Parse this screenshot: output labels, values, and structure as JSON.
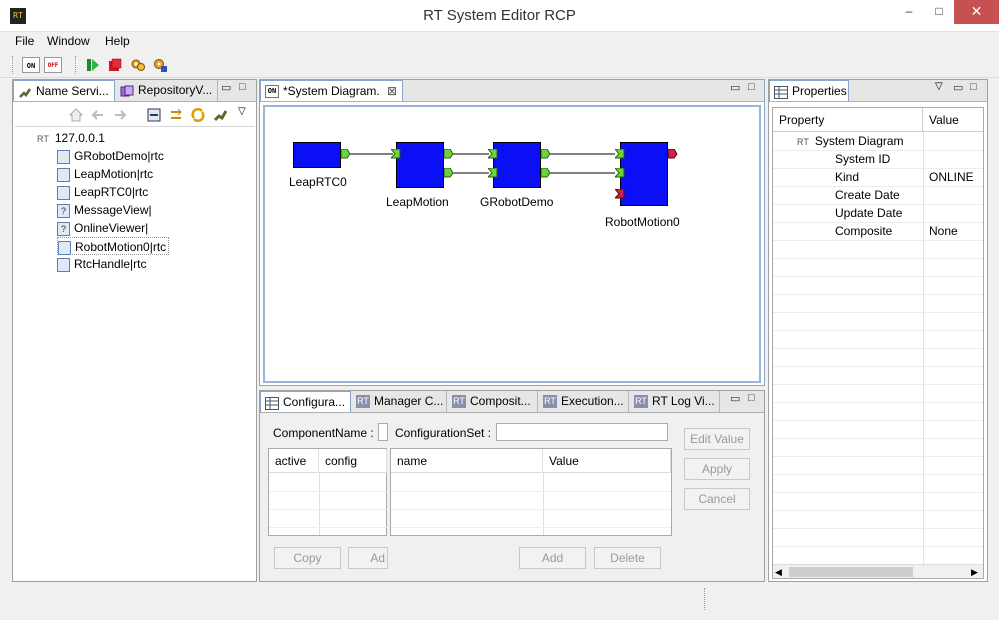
{
  "window": {
    "title": "RT System Editor RCP",
    "app_icon": "RT",
    "min": "–",
    "max": "□",
    "close": "✕"
  },
  "menu": [
    "File",
    "Window",
    "Help"
  ],
  "toolbar": {
    "on_label": "ON",
    "off_label": "OFF"
  },
  "name_service": {
    "tabs": [
      "Name Servi...",
      "RepositoryV..."
    ],
    "root": "127.0.0.1",
    "root_icon": "RT",
    "items": [
      "GRobotDemo|rtc",
      "LeapMotion|rtc",
      "LeapRTC0|rtc",
      "MessageView|",
      "OnlineViewer|",
      "RobotMotion0|rtc",
      "RtcHandle|rtc"
    ],
    "unknown_glyph": "?"
  },
  "diagram": {
    "tab": "*System Diagram.",
    "tab_icon": "ON",
    "components": [
      "LeapRTC0",
      "LeapMotion",
      "GRobotDemo",
      "RobotMotion0"
    ]
  },
  "config_panel": {
    "tabs": [
      "Configura...",
      "Manager C...",
      "Composit...",
      "Execution...",
      "RT Log Vi..."
    ],
    "component_name_label": "ComponentName :",
    "configuration_set_label": "ConfigurationSet :",
    "left_headers": [
      "active",
      "config"
    ],
    "right_headers": [
      "name",
      "Value"
    ],
    "buttons": {
      "edit_value": "Edit Value",
      "apply": "Apply",
      "cancel": "Cancel",
      "copy": "Copy",
      "add_left": "Ad",
      "add": "Add",
      "delete": "Delete"
    }
  },
  "properties": {
    "tab": "Properties",
    "headers": [
      "Property",
      "Value"
    ],
    "root": "System Diagram",
    "root_icon": "RT",
    "rows": [
      {
        "name": "System ID",
        "value": ""
      },
      {
        "name": "Kind",
        "value": "ONLINE"
      },
      {
        "name": "Create Date",
        "value": ""
      },
      {
        "name": "Update Date",
        "value": ""
      },
      {
        "name": "Composite",
        "value": "None"
      }
    ]
  },
  "colors": {
    "component": "#0a0ff5",
    "port_in": "#6bd33b",
    "port_out_red": "#cc2255",
    "close": "#c75050"
  }
}
